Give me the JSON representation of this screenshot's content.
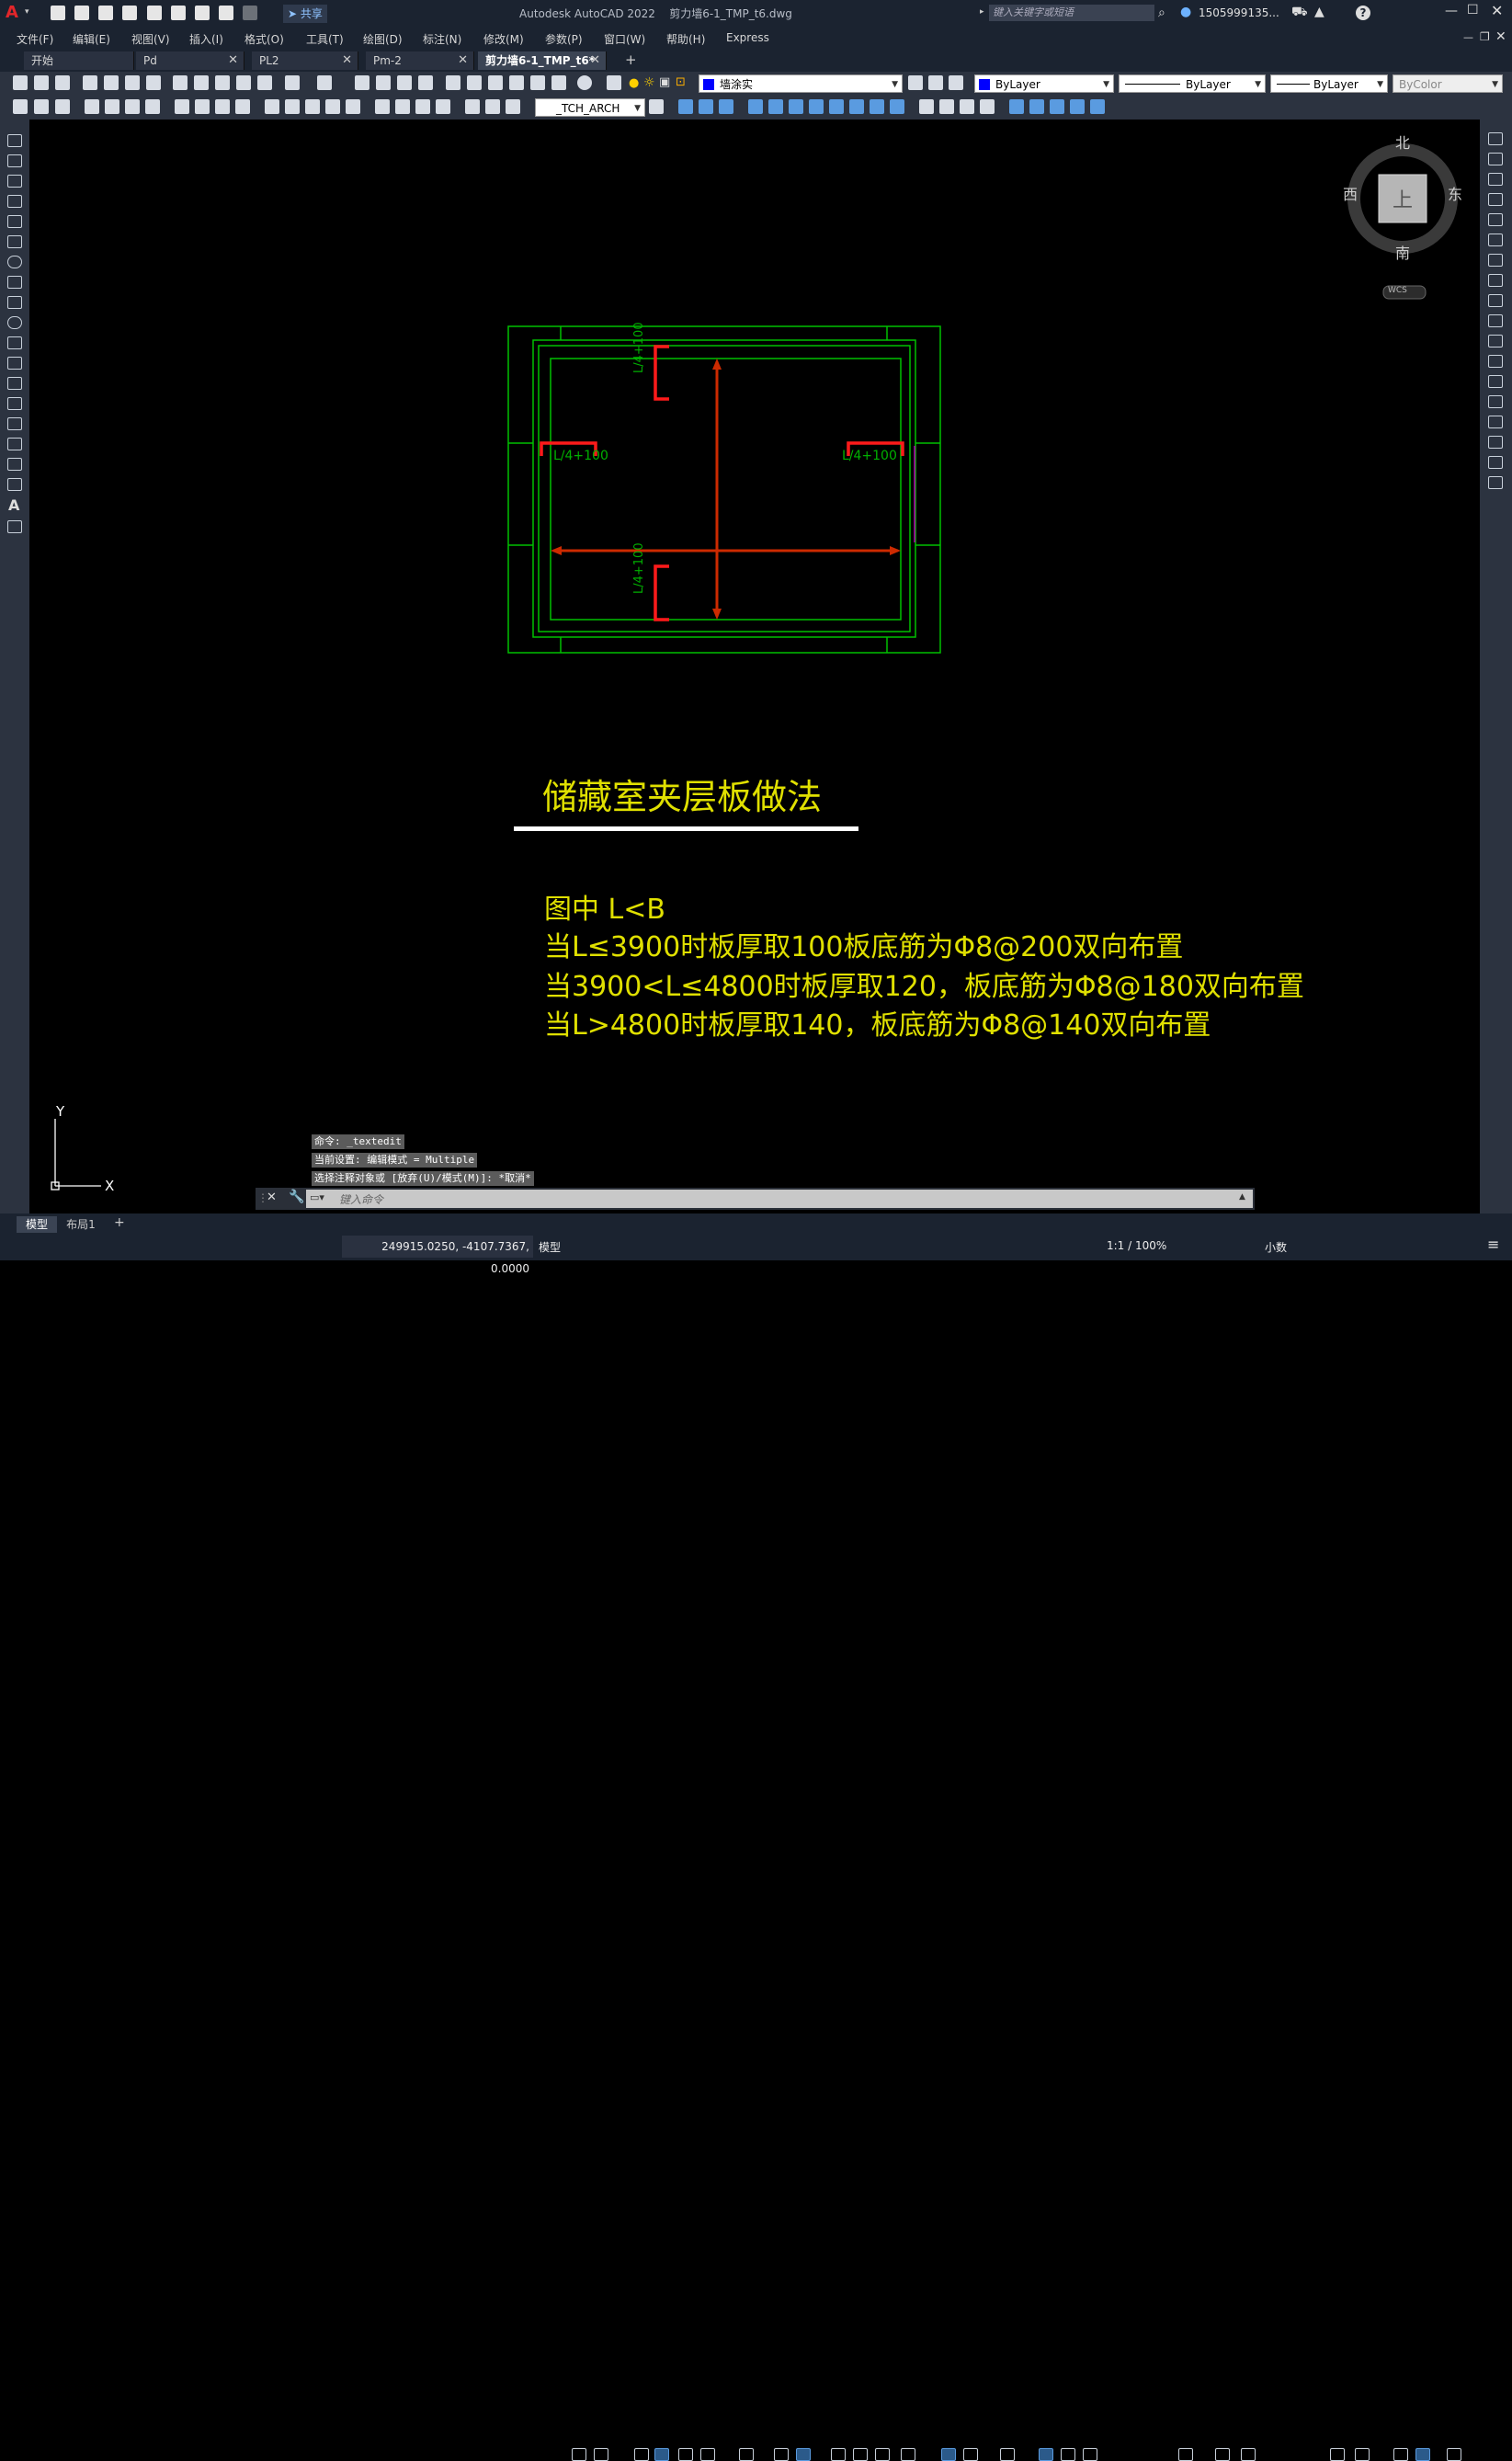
{
  "app": {
    "title": "Autodesk AutoCAD 2022",
    "filename": "剪力墙6-1_TMP_t6.dwg",
    "search_placeholder": "键入关键字或短语",
    "user": "1505999135...",
    "share_label": "共享"
  },
  "menu": [
    "文件(F)",
    "编辑(E)",
    "视图(V)",
    "插入(I)",
    "格式(O)",
    "工具(T)",
    "绘图(D)",
    "标注(N)",
    "修改(M)",
    "参数(P)",
    "窗口(W)",
    "帮助(H)",
    "Express"
  ],
  "doc_tabs": [
    {
      "label": "开始",
      "closable": false,
      "active": false
    },
    {
      "label": "Pd",
      "closable": true,
      "active": false
    },
    {
      "label": "PL2",
      "closable": true,
      "active": false
    },
    {
      "label": "Pm-2",
      "closable": true,
      "active": false
    },
    {
      "label": "剪力墙6-1_TMP_t6*",
      "closable": true,
      "active": true
    }
  ],
  "properties": {
    "layer": "墙涂实",
    "color": "ByLayer",
    "linetype": "ByLayer",
    "lineweight": "ByLayer",
    "plotstyle": "ByColor",
    "textstyle": "_TCH_ARCH",
    "layer_color": "#0000ff"
  },
  "viewcube": {
    "north": "北",
    "south": "南",
    "east": "东",
    "west": "西",
    "top": "上",
    "wcs": "WCS"
  },
  "drawing": {
    "labels": {
      "top": "L/4+100",
      "bottom": "L/4+100",
      "left": "L/4+100",
      "right": "L/4+100"
    },
    "title": "储藏室夹层板做法",
    "notes": [
      "图中 L<B",
      "当L≤3900时板厚取100板底筋为Φ8@200双向布置",
      "当3900<L≤4800时板厚取120，板底筋为Φ8@180双向布置",
      "当L>4800时板厚取140，板底筋为Φ8@140双向布置"
    ],
    "colors": {
      "wall": "#00c000",
      "rebar": "#cc2a00",
      "hook": "#ff1a1a",
      "text": "#e0e000",
      "label": "#00b000"
    }
  },
  "ucs": {
    "x": "X",
    "y": "Y"
  },
  "command": {
    "history": [
      "命令: _textedit",
      "当前设置: 编辑模式 = Multiple",
      "选择注释对象或 [放弃(U)/模式(M)]: *取消*"
    ],
    "placeholder": "键入命令"
  },
  "layout_tabs": [
    "模型",
    "布局1"
  ],
  "status": {
    "coords": "249915.0250, -4107.7367, 0.0000",
    "model": "模型",
    "scale": "1:1 / 100%",
    "units": "小数"
  }
}
